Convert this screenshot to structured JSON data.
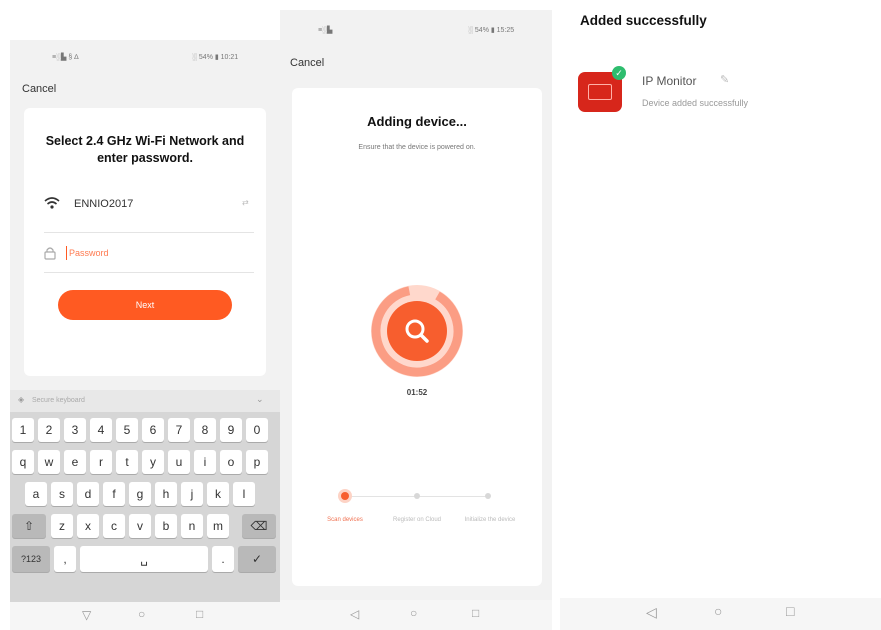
{
  "wifi_screen": {
    "status_left": "≡░▙ § ∆",
    "status_right": "░ 54% ▮ 10:21",
    "cancel_label": "Cancel",
    "title": "Select 2.4 GHz Wi-Fi Network and enter password.",
    "network_name": "ENNIO2017",
    "network_change_label": "⇄",
    "password_placeholder": "Password",
    "next_label": "Next",
    "keyboard": {
      "header_label": "Secure keyboard",
      "row1": [
        "1",
        "2",
        "3",
        "4",
        "5",
        "6",
        "7",
        "8",
        "9",
        "0"
      ],
      "row2": [
        "q",
        "w",
        "e",
        "r",
        "t",
        "y",
        "u",
        "i",
        "o",
        "p"
      ],
      "row3": [
        "a",
        "s",
        "d",
        "f",
        "g",
        "h",
        "j",
        "k",
        "l"
      ],
      "row4": [
        "z",
        "x",
        "c",
        "v",
        "b",
        "n",
        "m"
      ],
      "symbols_label": "?123",
      "comma_label": ",",
      "period_label": ".",
      "space_label": "␣"
    }
  },
  "adding_screen": {
    "status_left": "≡░▙",
    "status_right": "░ 54% ▮ 15:25",
    "cancel_label": "Cancel",
    "title": "Adding device...",
    "subtitle": "Ensure that the device is powered on.",
    "timer": "01:52",
    "steps": [
      {
        "label": "Scan devices",
        "active": true
      },
      {
        "label": "Register on Cloud",
        "active": false
      },
      {
        "label": "Initialize the device",
        "active": false
      }
    ]
  },
  "success_screen": {
    "title": "Added successfully",
    "device_name": "IP Monitor",
    "device_status": "Device added successfully"
  },
  "colors": {
    "accent": "#ff5a22",
    "success_badge": "#2ebd6e",
    "device_icon": "#d7261b"
  }
}
